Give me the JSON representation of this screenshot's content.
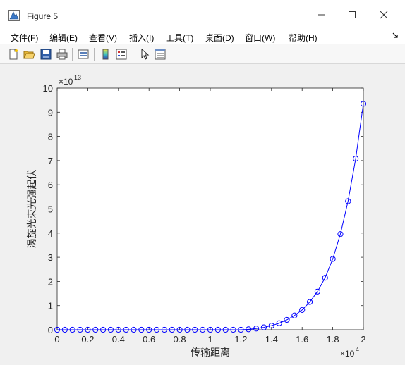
{
  "window": {
    "title": "Figure 5",
    "icon": "matlab-figure-icon",
    "controls": [
      "minimize-icon",
      "maximize-icon",
      "close-icon"
    ]
  },
  "menubar": {
    "items": [
      "文件(F)",
      "编辑(E)",
      "查看(V)",
      "插入(I)",
      "工具(T)",
      "桌面(D)",
      "窗口(W)",
      "帮助(H)"
    ]
  },
  "toolbar": {
    "buttons": [
      "new-figure-icon",
      "open-file-icon",
      "save-icon",
      "print-icon",
      "link-plot-icon",
      "insert-colorbar-icon",
      "insert-legend-icon",
      "edit-plot-arrow-icon",
      "property-inspector-icon"
    ]
  },
  "chart_data": {
    "type": "line",
    "xlabel": "传输距离",
    "ylabel": "涡旋光束光强起伏",
    "x_exponent_label": "×10",
    "x_exponent": "4",
    "y_exponent_label": "×10",
    "y_exponent": "13",
    "xlim": [
      0,
      20000
    ],
    "ylim": [
      0,
      100000000000000
    ],
    "xticks": [
      0,
      0.2,
      0.4,
      0.6,
      0.8,
      1,
      1.2,
      1.4,
      1.6,
      1.8,
      2
    ],
    "xtick_labels": [
      "0",
      "0.2",
      "0.4",
      "0.6",
      "0.8",
      "1",
      "1.2",
      "1.4",
      "1.6",
      "1.8",
      "2"
    ],
    "yticks": [
      0,
      1,
      2,
      3,
      4,
      5,
      6,
      7,
      8,
      9,
      10
    ],
    "ytick_labels": [
      "0",
      "1",
      "2",
      "3",
      "4",
      "5",
      "6",
      "7",
      "8",
      "9",
      "10"
    ],
    "grid": false,
    "line_color": "#0000ff",
    "marker": "circle",
    "series": [
      {
        "x": [
          0,
          500,
          1000,
          1500,
          2000,
          2500,
          3000,
          3500,
          4000,
          4500,
          5000,
          5500,
          6000,
          6500,
          7000,
          7500,
          8000,
          8500,
          9000,
          9500,
          10000,
          10500,
          11000,
          11500,
          12000,
          12500,
          13000,
          13500,
          14000,
          14500,
          15000,
          15500,
          16000,
          16500,
          17000,
          17500,
          18000,
          18500,
          19000,
          19500,
          20000
        ],
        "y": [
          0,
          0,
          0,
          0,
          0,
          0,
          0,
          0,
          0,
          0,
          0,
          0,
          0,
          0,
          0,
          0,
          0,
          0,
          0,
          0,
          0,
          0,
          0,
          0,
          0,
          200000000000,
          500000000000,
          1000000000000,
          1700000000000,
          2700000000000,
          4100000000000,
          5900000000000,
          8200000000000,
          11500000000000,
          15800000000000,
          21500000000000,
          29300000000000,
          39600000000000,
          53200000000000,
          70800000000000,
          93500000000000
        ]
      }
    ]
  }
}
